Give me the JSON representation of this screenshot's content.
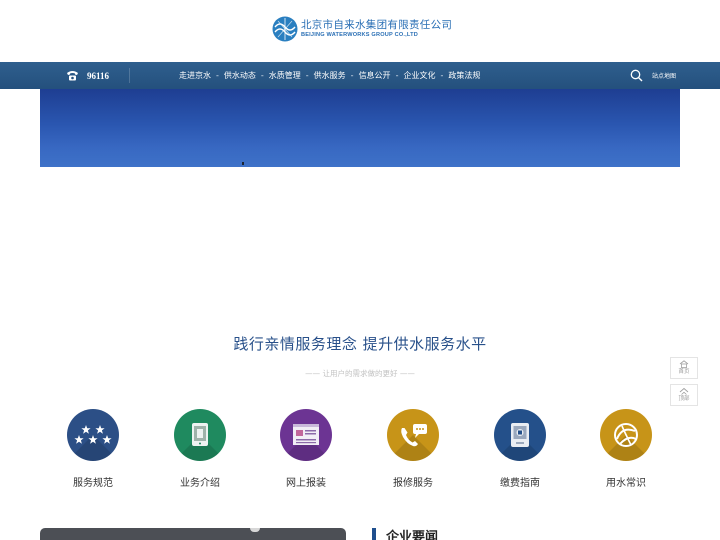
{
  "header": {
    "logo_cn": "北京市自来水集团有限责任公司",
    "logo_en": "BEIJING WATERWORKS GROUP CO.,LTD"
  },
  "nav": {
    "phone": "96116",
    "phone_icon": "telephone-icon",
    "items": [
      {
        "label": "走进京水"
      },
      {
        "label": "供水动态"
      },
      {
        "label": "水质管理"
      },
      {
        "label": "供水服务"
      },
      {
        "label": "信息公开"
      },
      {
        "label": "企业文化"
      },
      {
        "label": "政策法规"
      }
    ],
    "separator": "-",
    "search_icon": "search-icon",
    "sitemap": "站点地图"
  },
  "section": {
    "title": "践行亲情服务理念 提升供水服务水平",
    "subtitle": "—— 让用户的需求做的更好 ——"
  },
  "services": [
    {
      "label": "服务规范",
      "color": "#2c4f86",
      "icon": "stars-icon"
    },
    {
      "label": "业务介绍",
      "color": "#1f8a5f",
      "icon": "tablet-icon"
    },
    {
      "label": "网上报装",
      "color": "#6c3493",
      "icon": "browser-form-icon"
    },
    {
      "label": "报修服务",
      "color": "#c79418",
      "icon": "phone-chat-icon"
    },
    {
      "label": "缴费指南",
      "color": "#24508a",
      "icon": "payment-device-icon"
    },
    {
      "label": "用水常识",
      "color": "#c79418",
      "icon": "globe-icon"
    }
  ],
  "float": {
    "home": "首页",
    "top": "顶部"
  },
  "news": {
    "title": "企业要闻"
  },
  "colors": {
    "nav_bg": "#24507d",
    "brand": "#2a6fb5",
    "title": "#28508a"
  }
}
